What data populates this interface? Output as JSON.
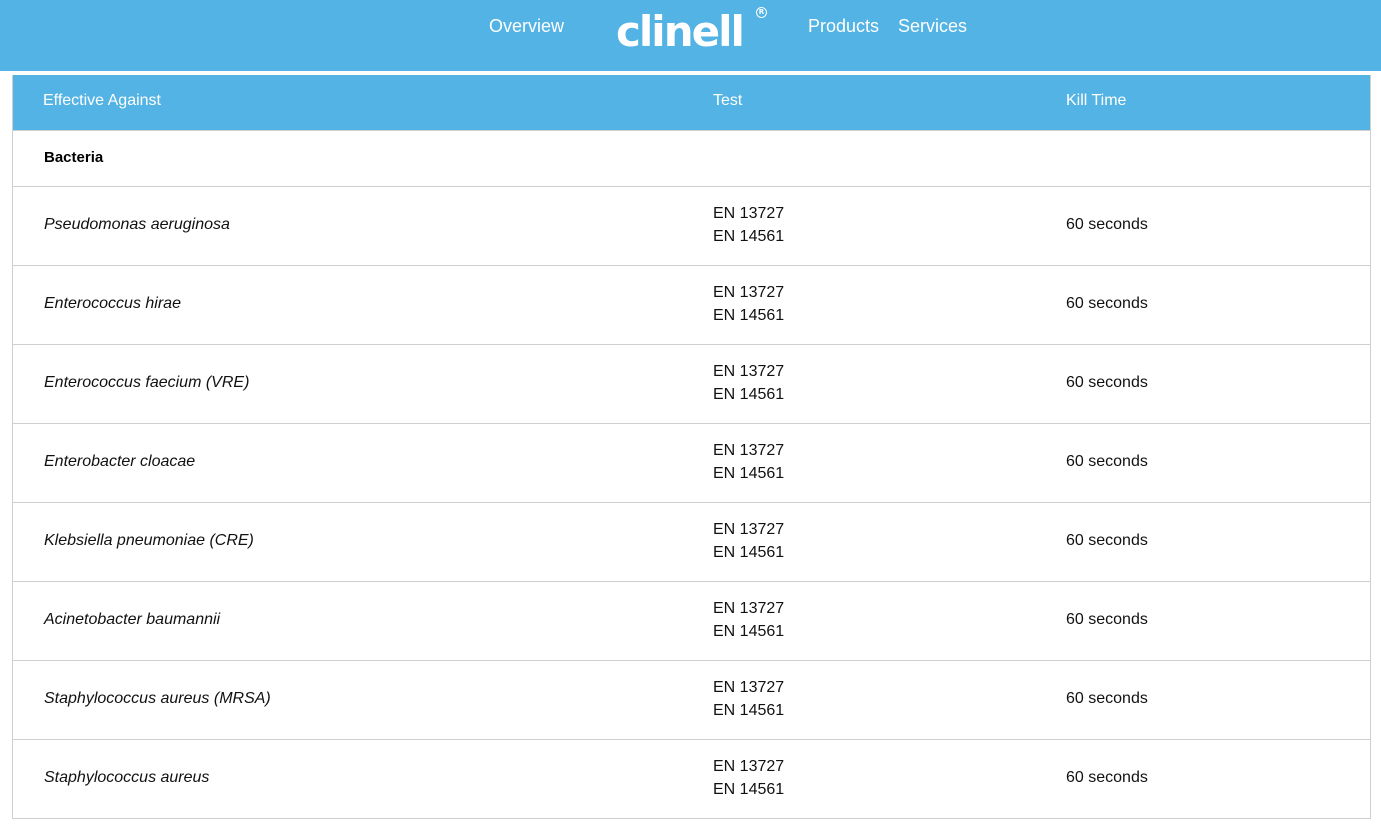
{
  "brand": {
    "logo_text": "clinell",
    "registered_mark": "R"
  },
  "nav": {
    "overview": "Overview",
    "products": "Products",
    "services": "Services"
  },
  "colors": {
    "header_bg": "#52b3e4",
    "header_text": "#ffffff",
    "row_border": "#cfcfcf"
  },
  "table": {
    "headers": [
      "Effective Against",
      "Test",
      "Kill Time"
    ],
    "section": "Bacteria",
    "rows": [
      {
        "organism": "Pseudomonas aeruginosa",
        "tests": [
          "EN 13727",
          "EN 14561"
        ],
        "kill_time": "60 seconds"
      },
      {
        "organism": "Enterococcus hirae",
        "tests": [
          "EN 13727",
          "EN 14561"
        ],
        "kill_time": "60 seconds"
      },
      {
        "organism": "Enterococcus faecium (VRE)",
        "tests": [
          "EN 13727",
          "EN 14561"
        ],
        "kill_time": "60 seconds"
      },
      {
        "organism": "Enterobacter cloacae",
        "tests": [
          "EN 13727",
          "EN 14561"
        ],
        "kill_time": "60 seconds"
      },
      {
        "organism": "Klebsiella pneumoniae (CRE)",
        "tests": [
          "EN 13727",
          "EN 14561"
        ],
        "kill_time": "60 seconds"
      },
      {
        "organism": "Acinetobacter baumannii",
        "tests": [
          "EN 13727",
          "EN 14561"
        ],
        "kill_time": "60 seconds"
      },
      {
        "organism": "Staphylococcus aureus (MRSA)",
        "tests": [
          "EN 13727",
          "EN 14561"
        ],
        "kill_time": "60 seconds"
      },
      {
        "organism": "Staphylococcus aureus",
        "tests": [
          "EN 13727",
          "EN 14561"
        ],
        "kill_time": "60 seconds"
      }
    ]
  }
}
